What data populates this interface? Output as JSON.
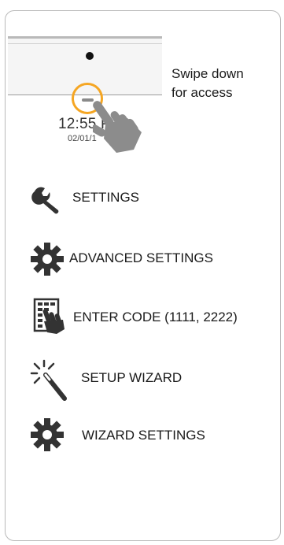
{
  "instruction": {
    "line1": "Swipe down",
    "line2": "for access"
  },
  "lock_screen": {
    "time": "12:55 P",
    "date": "02/01/1"
  },
  "menu": [
    {
      "label": "SETTINGS",
      "icon": "wrench-icon"
    },
    {
      "label": "ADVANCED SETTINGS",
      "icon": "gear-icon"
    },
    {
      "label": "ENTER CODE (1111, 2222)",
      "icon": "keypad-hand-icon"
    },
    {
      "label": "SETUP WIZARD",
      "icon": "magic-wand-icon"
    },
    {
      "label": "WIZARD SETTINGS",
      "icon": "gear-icon"
    }
  ],
  "colors": {
    "accent": "#f5a623",
    "text": "#1a1a1a",
    "border": "#b9b9b9"
  }
}
